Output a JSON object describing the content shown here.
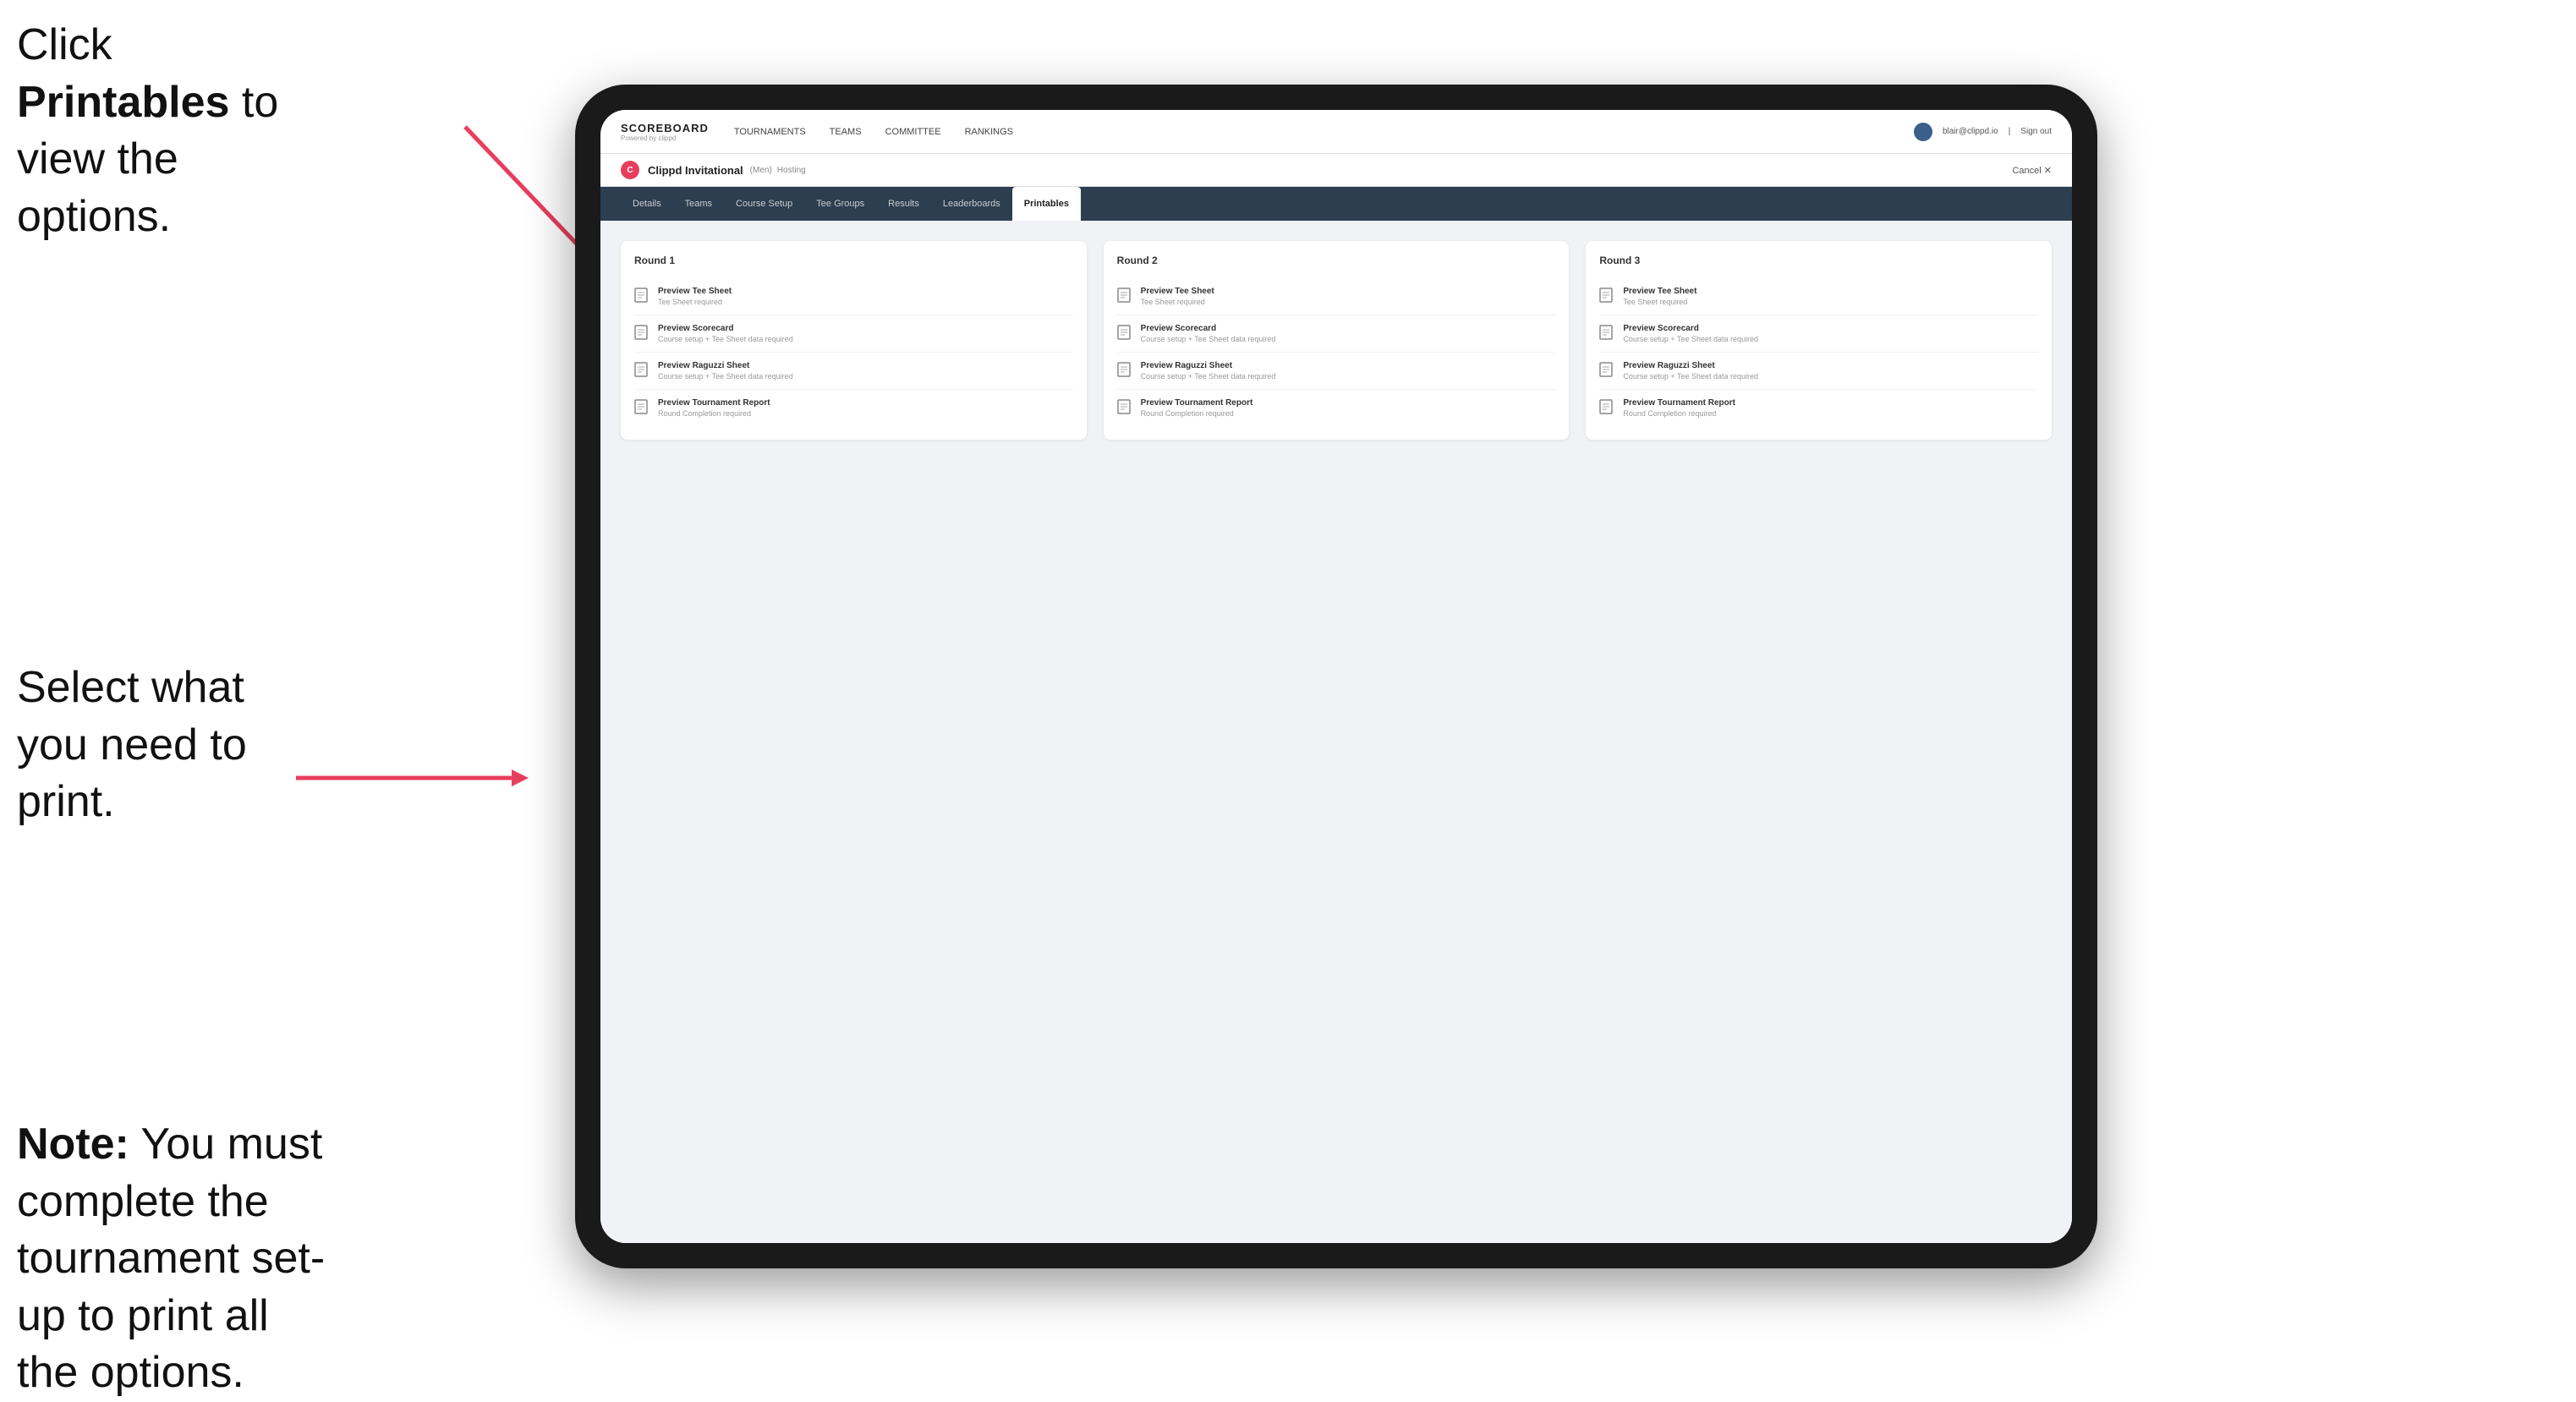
{
  "annotations": {
    "top": {
      "text_before": "Click ",
      "bold_text": "Printables",
      "text_after": " to view the options."
    },
    "middle": {
      "text": "Select what you need to print."
    },
    "bottom": {
      "text_before": "",
      "bold_text": "Note:",
      "text_after": " You must complete the tournament set-up to print all the options."
    }
  },
  "top_nav": {
    "logo": "SCOREBOARD",
    "logo_sub": "Powered by clippd",
    "links": [
      {
        "label": "TOURNAMENTS",
        "active": false
      },
      {
        "label": "TEAMS",
        "active": false
      },
      {
        "label": "COMMITTEE",
        "active": false
      },
      {
        "label": "RANKINGS",
        "active": false
      }
    ],
    "user_email": "blair@clippd.io",
    "sign_out": "Sign out"
  },
  "sub_header": {
    "tournament_name": "Clippd Invitational",
    "badge": "(Men)",
    "status": "Hosting",
    "cancel": "Cancel ✕"
  },
  "tabs": [
    {
      "label": "Details",
      "active": false
    },
    {
      "label": "Teams",
      "active": false
    },
    {
      "label": "Course Setup",
      "active": false
    },
    {
      "label": "Tee Groups",
      "active": false
    },
    {
      "label": "Results",
      "active": false
    },
    {
      "label": "Leaderboards",
      "active": false
    },
    {
      "label": "Printables",
      "active": true
    }
  ],
  "rounds": [
    {
      "title": "Round 1",
      "items": [
        {
          "title": "Preview Tee Sheet",
          "subtitle": "Tee Sheet required"
        },
        {
          "title": "Preview Scorecard",
          "subtitle": "Course setup + Tee Sheet data required"
        },
        {
          "title": "Preview Raguzzi Sheet",
          "subtitle": "Course setup + Tee Sheet data required"
        },
        {
          "title": "Preview Tournament Report",
          "subtitle": "Round Completion required"
        }
      ]
    },
    {
      "title": "Round 2",
      "items": [
        {
          "title": "Preview Tee Sheet",
          "subtitle": "Tee Sheet required"
        },
        {
          "title": "Preview Scorecard",
          "subtitle": "Course setup + Tee Sheet data required"
        },
        {
          "title": "Preview Raguzzi Sheet",
          "subtitle": "Course setup + Tee Sheet data required"
        },
        {
          "title": "Preview Tournament Report",
          "subtitle": "Round Completion required"
        }
      ]
    },
    {
      "title": "Round 3",
      "items": [
        {
          "title": "Preview Tee Sheet",
          "subtitle": "Tee Sheet required"
        },
        {
          "title": "Preview Scorecard",
          "subtitle": "Course setup + Tee Sheet data required"
        },
        {
          "title": "Preview Raguzzi Sheet",
          "subtitle": "Course setup + Tee Sheet data required"
        },
        {
          "title": "Preview Tournament Report",
          "subtitle": "Round Completion required"
        }
      ]
    }
  ]
}
